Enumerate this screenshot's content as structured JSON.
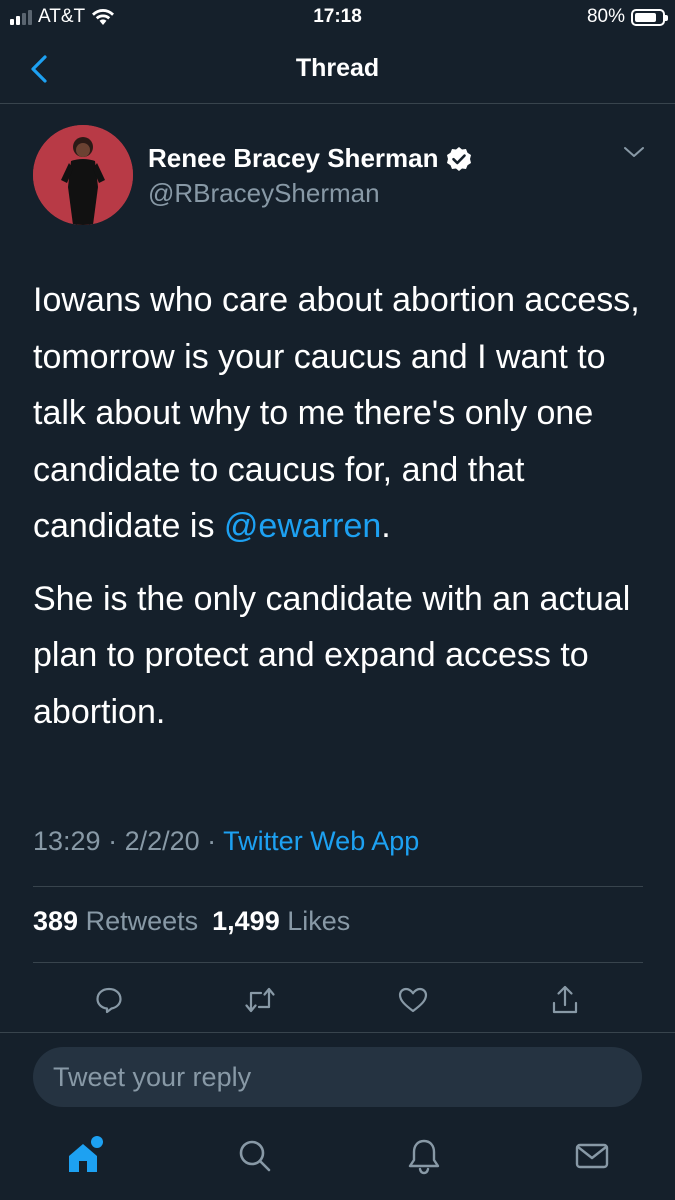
{
  "status_bar": {
    "carrier": "AT&T",
    "time": "17:18",
    "battery_percent": "80%",
    "battery_level": 0.8,
    "signal_bars": 2,
    "wifi_icon": "wifi-icon"
  },
  "nav": {
    "title": "Thread",
    "back_icon": "chevron-left-icon"
  },
  "tweet": {
    "author_name": "Renee Bracey Sherman",
    "verified_icon": "verified-badge-icon",
    "handle": "@RBraceySherman",
    "body_p1_text": "Iowans who care about abortion access, tomorrow is your caucus and I want to talk about why to me there's only one candidate to caucus for, and that candidate is ",
    "body_p1_mention": "@ewarren",
    "body_p1_end": ".",
    "body_p2": "She is the only candidate with an actual plan to protect and expand access to abortion.",
    "time": "13:29",
    "date": "2/2/20",
    "separator": " · ",
    "source": "Twitter Web App",
    "retweets_count": "389",
    "retweets_label": "Retweets",
    "likes_count": "1,499",
    "likes_label": "Likes"
  },
  "actions": [
    "reply-icon",
    "retweet-icon",
    "like-icon",
    "share-icon"
  ],
  "reply": {
    "placeholder": "Tweet your reply"
  },
  "tabs": [
    "home-icon",
    "search-icon",
    "notifications-icon",
    "messages-icon"
  ],
  "colors": {
    "background": "#15202b",
    "accent": "#1da1f2",
    "secondary_text": "#8899a6",
    "divider": "#38444d",
    "avatar_bg": "#b83a46"
  }
}
